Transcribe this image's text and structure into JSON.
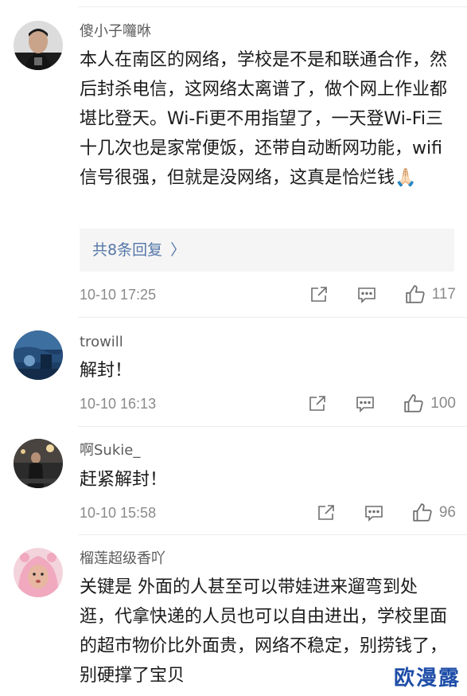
{
  "comments": [
    {
      "username": "傻小子囖咻",
      "text": "本人在南区的网络，学校是不是和联通合作，然后封杀电信，这网络太离谱了，做个网上作业都堪比登天。Wi-Fi更不用指望了，一天登Wi-Fi三十几次也是家常便饭，还带自动断网功能，wifi信号很强，但就是没网络，这真是恰烂钱🙏🏻",
      "replies_label": "共8条回复",
      "replies_chevron": "〉",
      "timestamp": "10-10 17:25",
      "likes": "117",
      "avatar": "man-black-shirt"
    },
    {
      "username": "trowill",
      "text": "解封！",
      "timestamp": "10-10 16:13",
      "likes": "100",
      "avatar": "blue-scene"
    },
    {
      "username": "啊Sukie_",
      "text": "赶紧解封！",
      "timestamp": "10-10 15:58",
      "likes": "96",
      "avatar": "night-street"
    },
    {
      "username": "榴莲超级香吖",
      "text": "关键是 外面的人甚至可以带娃进来遛弯到处逛，代拿快递的人员也可以自由进出，学校里面的超市物价比外面贵，网络不稳定，别捞钱了，别硬撑了宝贝",
      "avatar": "pink-hood"
    }
  ],
  "icons": {
    "share": "share-icon",
    "comment": "comment-icon",
    "like": "thumbs-up-icon"
  },
  "colors": {
    "username": "#5b5b5b",
    "reply_link": "#5577a8",
    "meta": "#8a8a8a",
    "watermark": "#1f4ea8"
  },
  "watermark": "欧漫露"
}
